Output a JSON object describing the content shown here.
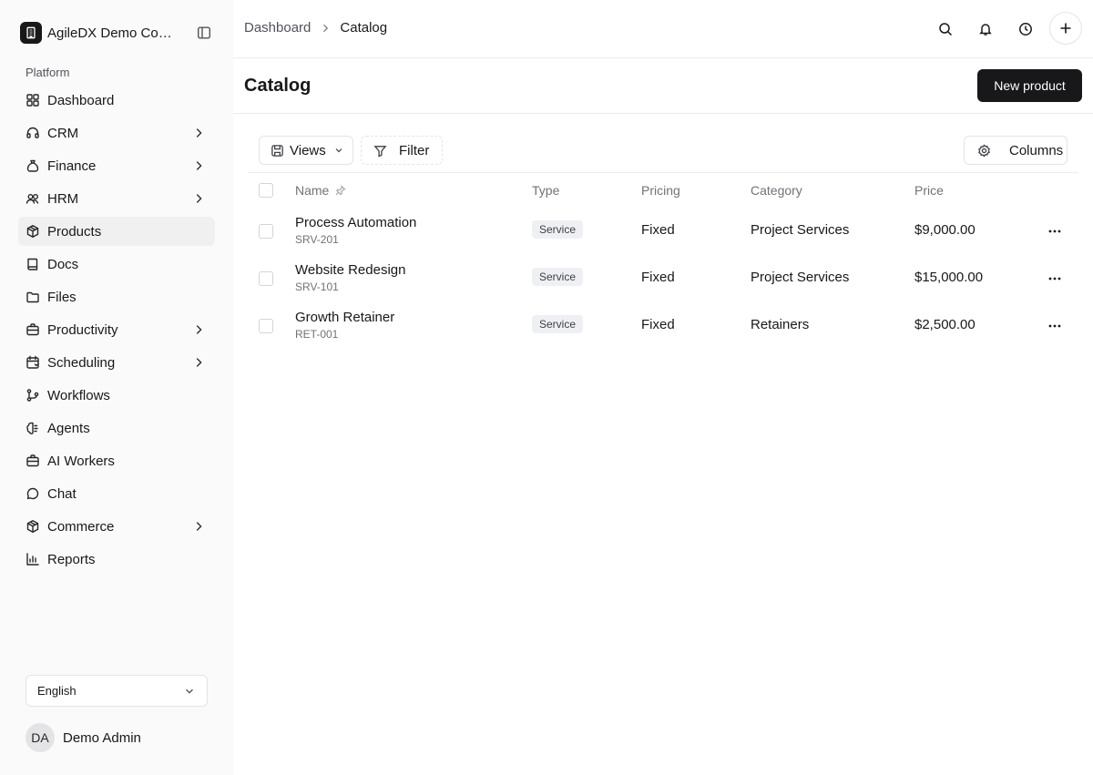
{
  "sidebar": {
    "org_name": "AgileDX Demo Com...",
    "section_label": "Platform",
    "items": [
      {
        "label": "Dashboard",
        "icon": "grid-icon",
        "chevron": false,
        "active": false
      },
      {
        "label": "CRM",
        "icon": "headset-icon",
        "chevron": true,
        "active": false
      },
      {
        "label": "Finance",
        "icon": "money-bag-icon",
        "chevron": true,
        "active": false
      },
      {
        "label": "HRM",
        "icon": "users-icon",
        "chevron": true,
        "active": false
      },
      {
        "label": "Products",
        "icon": "package-icon",
        "chevron": false,
        "active": true
      },
      {
        "label": "Docs",
        "icon": "book-icon",
        "chevron": false,
        "active": false
      },
      {
        "label": "Files",
        "icon": "folder-icon",
        "chevron": false,
        "active": false
      },
      {
        "label": "Productivity",
        "icon": "briefcase-icon",
        "chevron": true,
        "active": false
      },
      {
        "label": "Scheduling",
        "icon": "calendar-icon",
        "chevron": true,
        "active": false
      },
      {
        "label": "Workflows",
        "icon": "git-branch-icon",
        "chevron": false,
        "active": false
      },
      {
        "label": "Agents",
        "icon": "brain-icon",
        "chevron": false,
        "active": false
      },
      {
        "label": "AI Workers",
        "icon": "briefcase-icon",
        "chevron": false,
        "active": false
      },
      {
        "label": "Chat",
        "icon": "chat-icon",
        "chevron": false,
        "active": false
      },
      {
        "label": "Commerce",
        "icon": "package-icon",
        "chevron": true,
        "active": false
      },
      {
        "label": "Reports",
        "icon": "chart-icon",
        "chevron": false,
        "active": false
      }
    ],
    "language": "English",
    "user": {
      "initials": "DA",
      "name": "Demo Admin"
    }
  },
  "topbar": {
    "breadcrumb_root": "Dashboard",
    "breadcrumb_current": "Catalog"
  },
  "page": {
    "title": "Catalog",
    "new_button": "New product"
  },
  "toolbar": {
    "views_label": "Views",
    "filter_label": "Filter",
    "columns_label": "Columns"
  },
  "table": {
    "headers": {
      "name": "Name",
      "type": "Type",
      "pricing": "Pricing",
      "category": "Category",
      "price": "Price"
    },
    "rows": [
      {
        "name": "Process Automation",
        "code": "SRV-201",
        "type": "Service",
        "pricing": "Fixed",
        "category": "Project Services",
        "price": "$9,000.00"
      },
      {
        "name": "Website Redesign",
        "code": "SRV-101",
        "type": "Service",
        "pricing": "Fixed",
        "category": "Project Services",
        "price": "$15,000.00"
      },
      {
        "name": "Growth Retainer",
        "code": "RET-001",
        "type": "Service",
        "pricing": "Fixed",
        "category": "Retainers",
        "price": "$2,500.00"
      }
    ]
  },
  "colors": {
    "primary": "#18181b",
    "sidebar_bg": "#fafafa",
    "active_bg": "#f0f0f1",
    "muted_text": "#71717a",
    "badge_bg": "#eef0f4"
  }
}
